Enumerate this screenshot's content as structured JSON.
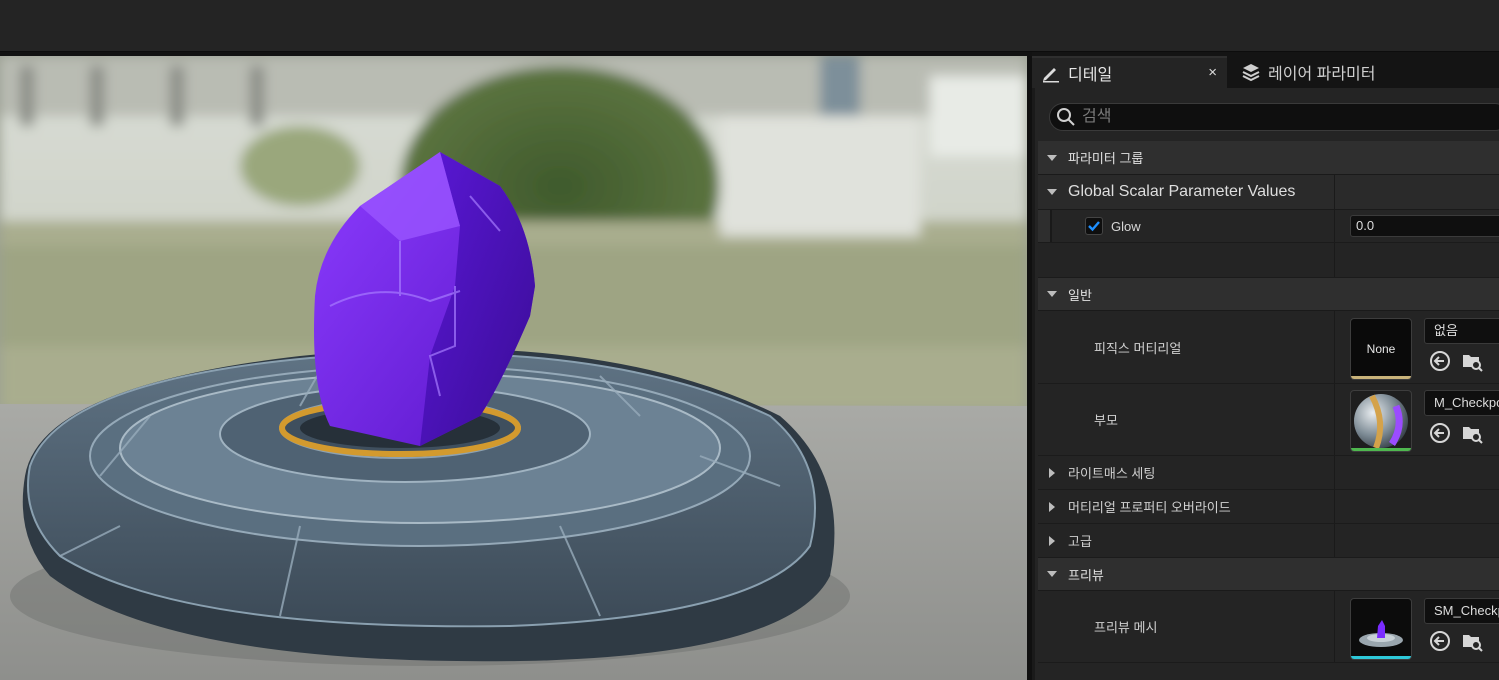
{
  "tabs": {
    "details_label": "디테일",
    "close_symbol": "×",
    "layer_params_label": "레이어 파라미터"
  },
  "search": {
    "placeholder": "검색"
  },
  "sections": {
    "parameter_groups": "파라미터 그룹",
    "global_scalar": "Global Scalar Parameter Values",
    "general": "일반",
    "lightmass": "라이트매스 세팅",
    "material_property_overrides": "머티리얼 프로퍼티 오버라이드",
    "advanced": "고급",
    "preview": "프리뷰"
  },
  "glow": {
    "label": "Glow",
    "checked": true,
    "value": "0.0"
  },
  "physics_material": {
    "label": "피직스 머티리얼",
    "thumb_text": "None",
    "value": "없음"
  },
  "parent": {
    "label": "부모",
    "value": "M_Checkpo"
  },
  "preview_mesh": {
    "label": "프리뷰 메시",
    "value": "SM_Checkp"
  },
  "icons": {
    "details_tab": "pencil-icon",
    "layer_tab": "layers-icon",
    "search": "search-icon",
    "use_selected": "arrow-left-circle-icon",
    "browse": "folder-search-icon"
  },
  "colors": {
    "accent_blue": "#1e8fff",
    "physics_bar": "#c9b37a",
    "parent_bar": "#4fb84f",
    "preview_bar": "#2ec8d8",
    "crystal": "#6a1fe0"
  }
}
